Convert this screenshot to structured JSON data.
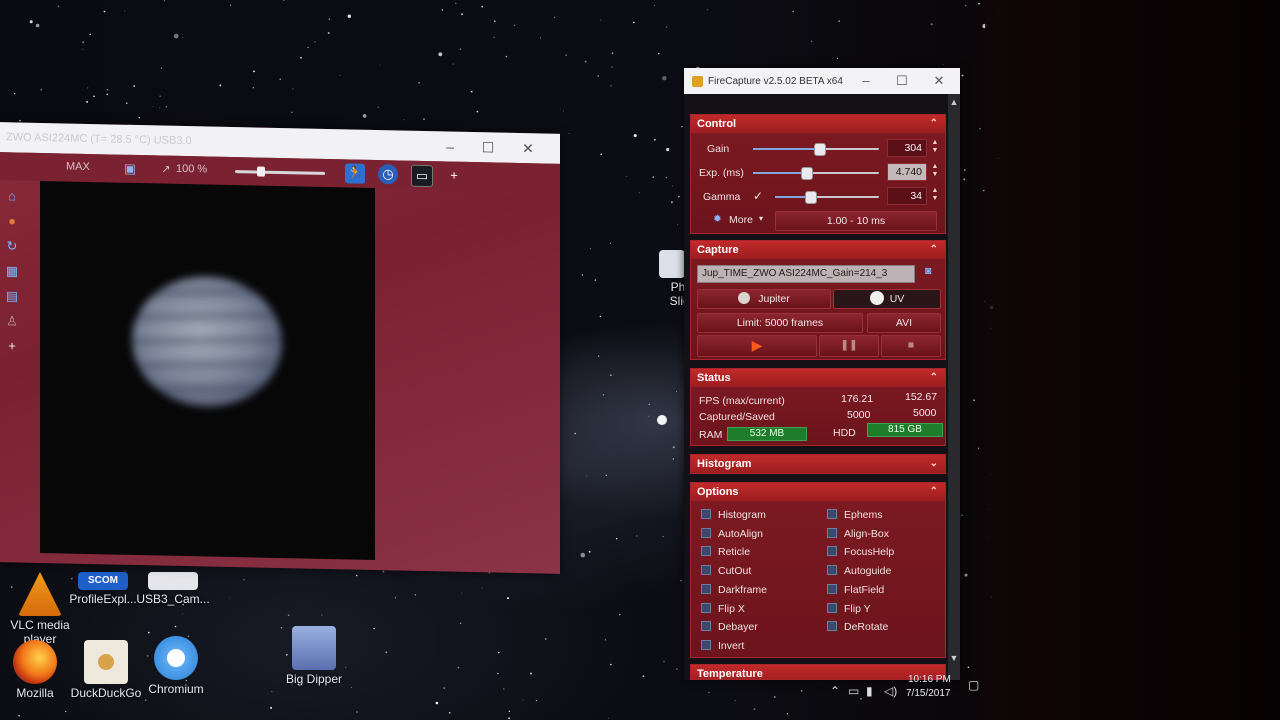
{
  "desktop": {
    "icons": [
      {
        "label": "VLC media player",
        "icon": "vlc-icon"
      },
      {
        "label": "ProfileExpl...",
        "icon": "profile-explorer-icon"
      },
      {
        "label": "USB3_Cam...",
        "icon": "usb3-camera-icon"
      },
      {
        "label": "Mozilla",
        "icon": "firefox-icon"
      },
      {
        "label": "DuckDuckGo",
        "icon": "duckduckgo-icon"
      },
      {
        "label": "Chromium",
        "icon": "chromium-icon"
      },
      {
        "label": "Big Dipper",
        "icon": "big-dipper-image-icon"
      },
      {
        "label": "Phot Slide",
        "icon": "photo-slideshow-icon"
      }
    ]
  },
  "camera_window": {
    "title": "ZWO ASI224MC (T= 28.5 °C) USB3.0",
    "toolbar": {
      "max_label": "MAX",
      "zoom_label": "100 %",
      "zoom_icon": "magnify-icon",
      "fullscreen_icon": "screen-icon",
      "run_icon": "running-man-icon",
      "history_icon": "clock-icon",
      "terminal_icon": "terminal-icon",
      "add_icon": "plus-icon"
    },
    "preview_object": "planet-jupiter-icon"
  },
  "firecapture": {
    "title": "FireCapture v2.5.02 BETA x64",
    "control": {
      "header": "Control",
      "gain_label": "Gain",
      "gain_value": "304",
      "gain_level": 0.52,
      "exp_label": "Exp. (ms)",
      "exp_value": "4.740",
      "exp_level": 0.42,
      "gamma_label": "Gamma",
      "gamma_checked": "✓",
      "gamma_value": "34",
      "gamma_level": 0.34,
      "more_label": "More",
      "range_label": "1.00 - 10 ms"
    },
    "capture": {
      "header": "Capture",
      "filename": "Jup_TIME_ZWO ASI224MC_Gain=214_3",
      "object_label": "Jupiter",
      "filter_label": "UV",
      "limit_label": "Limit: 5000 frames",
      "format_label": "AVI"
    },
    "status": {
      "header": "Status",
      "fps_label": "FPS (max/current)",
      "fps_max": "176.21",
      "fps_current": "152.67",
      "captured_label": "Captured/Saved",
      "captured": "5000",
      "saved": "5000",
      "ram_label": "RAM",
      "ram_value": "532 MB",
      "hdd_label": "HDD",
      "hdd_value": "815 GB"
    },
    "histogram": {
      "header": "Histogram"
    },
    "options": {
      "header": "Options",
      "left": [
        "Histogram",
        "AutoAlign",
        "Reticle",
        "CutOut",
        "Darkframe",
        "Flip X",
        "Debayer",
        "Invert"
      ],
      "right": [
        "Ephems",
        "Align-Box",
        "FocusHelp",
        "Autoguide",
        "FlatField",
        "Flip Y",
        "DeRotate"
      ]
    },
    "next_panel": {
      "header": "Temperature"
    }
  },
  "tray": {
    "time": "10:16 PM",
    "date": "7/15/2017"
  },
  "colors": {
    "panel_red": "#7e1a22",
    "header_red": "#c22a2a",
    "meter_green": "#1d7d2a",
    "camera_bg": "#8a2a3a"
  }
}
